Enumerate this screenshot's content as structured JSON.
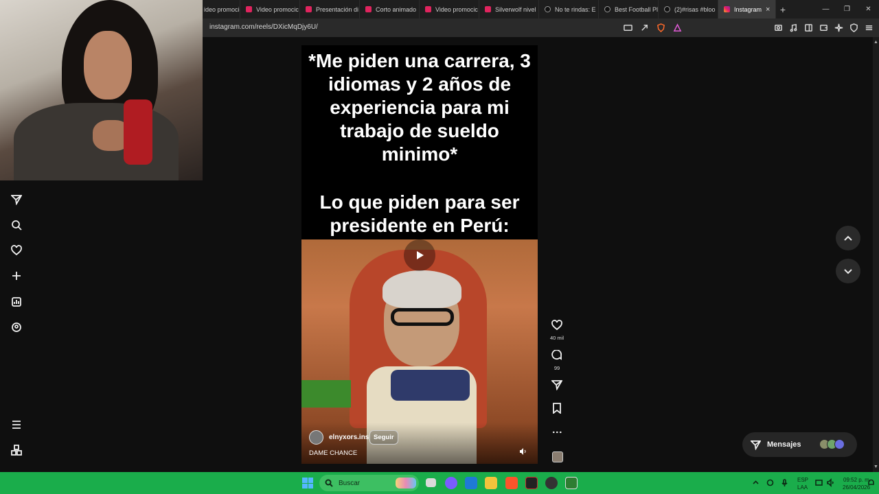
{
  "browser": {
    "tabs": [
      {
        "label": "ideo promocic",
        "icon": "youtube-icon"
      },
      {
        "label": "Video promocic",
        "icon": "youtube-icon"
      },
      {
        "label": "Presentación di",
        "icon": "youtube-icon"
      },
      {
        "label": "Corto animado",
        "icon": "youtube-icon"
      },
      {
        "label": "Video promocic",
        "icon": "youtube-icon"
      },
      {
        "label": "Silverwolf nivel",
        "icon": "youtube-icon"
      },
      {
        "label": "No te rindas: E",
        "icon": "tiktok-icon"
      },
      {
        "label": "Best Football Pl",
        "icon": "tiktok-icon"
      },
      {
        "label": "(2)#risas #bloo",
        "icon": "tiktok-icon"
      }
    ],
    "active_tab": {
      "label": "Instagram",
      "icon": "instagram-icon"
    },
    "url": "instagram.com/reels/DXicMqDjy6U/",
    "new_tab_symbol": "+",
    "close_symbol": "×"
  },
  "reel": {
    "text_top": "*Me piden una carrera, 3 idiomas y 2 años de experiencia para mi trabajo de sueldo minimo*",
    "text_bottom": "Lo que piden para ser presidente en Perú:",
    "username": "elnyxors.ins",
    "follow_label": "Seguir",
    "audio_title": "DAME CHANCE"
  },
  "actions": {
    "likes": "40 mil",
    "comments": "99"
  },
  "messages": {
    "label": "Mensajes"
  },
  "taskbar": {
    "search_placeholder": "Buscar",
    "language": "ESP",
    "layout": "LAA",
    "time": "09:52 p. m.",
    "date": "26/04/2026"
  },
  "colors": {
    "taskbar": "#1aad4b",
    "background": "#0f0f0f",
    "tab_active": "#3a3a3a"
  }
}
